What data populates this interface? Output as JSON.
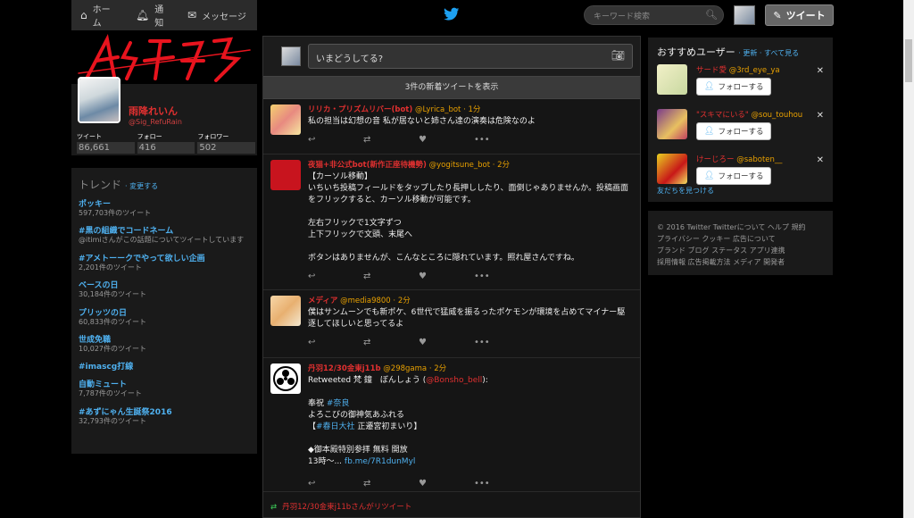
{
  "nav": {
    "home": "ホーム",
    "notifications": "通知",
    "messages": "メッセージ",
    "search_placeholder": "キーワード検索",
    "tweet_button": "ツイート"
  },
  "profile": {
    "name": "雨降れいん",
    "handle": "@Sig_RefuRain",
    "stats": [
      {
        "label": "ツイート",
        "value": "86,661"
      },
      {
        "label": "フォロー",
        "value": "416"
      },
      {
        "label": "フォロワー",
        "value": "502"
      }
    ]
  },
  "trends": {
    "title": "トレンド",
    "change": "· 変更する",
    "items": [
      {
        "title": "ポッキー",
        "sub": "597,703件のツイート"
      },
      {
        "title": "#黒の組織でコードネーム",
        "sub": "@itimiさんがこの話題についてツイートしています"
      },
      {
        "title": "#アメトーークでやって欲しい企画",
        "sub": "2,201件のツイート"
      },
      {
        "title": "ベースの日",
        "sub": "30,184件のツイート"
      },
      {
        "title": "プリッツの日",
        "sub": "60,833件のツイート"
      },
      {
        "title": "世成免職",
        "sub": "10,027件のツイート"
      },
      {
        "title": "#imascg打線",
        "sub": ""
      },
      {
        "title": "自動ミュート",
        "sub": "7,787件のツイート"
      },
      {
        "title": "#あずにゃん生誕祭2016",
        "sub": "32,793件のツイート"
      }
    ]
  },
  "composer": {
    "placeholder": "いまどうしてる?"
  },
  "new_tweets": "3件の新着ツイートを表示",
  "tweets": [
    {
      "name": "リリカ・プリズムリバー(bot)",
      "handle": "@Lyrica_bot",
      "time": "· 1分",
      "body": "私の担当は幻想の音 私が居ないと姉さん達の演奏は危険なのよ"
    },
    {
      "name": "夜猫+非公式bot(新作正座待機勢)",
      "handle": "@yogitsune_bot",
      "time": "· 2分",
      "body": "【カーソル移動】\nいちいち投稿フィールドをタップしたり長押ししたり、面倒じゃありませんか。投稿画面をフリックすると、カーソル移動が可能です。\n\n左右フリックで1文字ずつ\n上下フリックで文頭、末尾へ\n\nボタンはありませんが、こんなところに隠れています。照れ屋さんですね。"
    },
    {
      "name": "メディア",
      "handle": "@media9800",
      "time": "· 2分",
      "body": "僕はサンムーンでも新ポケ、6世代で猛威を振るったポケモンが環境を占めてマイナー駆逐してほしいと思ってるよ"
    },
    {
      "name": "丹羽12/30金東j11b",
      "handle": "@298gama",
      "time": "· 2分",
      "body_retweeted": "Retweeted 梵 鐘　ぼんしょう (",
      "body_retweeted_handle": "@Bonsho_bell",
      "body_retweeted_end": "):",
      "body_line2a": "奉祝 ",
      "body_tag1": "#奈良",
      "body_line3": "よろこびの御神気あふれる",
      "body_line4a": "【",
      "body_tag2": "#春日大社",
      "body_line4b": " 正遷宮初まいり】",
      "body_line5": "◆御本殿特別参拝 無料 開放",
      "body_line6a": "13時〜... ",
      "body_link": "fb.me/7R1dunMyl"
    }
  ],
  "retweet_line": "丹羽12/30金東j11bさんがリツイート",
  "who": {
    "title": "おすすめユーザー",
    "links": "· 更新 · すべて見る",
    "users": [
      {
        "name": "サード愛",
        "handle": "@3rd_eye_ya"
      },
      {
        "name": "\"スキマにいる\"",
        "handle": "@sou_touhou"
      },
      {
        "name": "けーじろー",
        "handle": "@saboten__"
      }
    ],
    "follow_label": "フォローする",
    "find_friends": "友だちを見つける"
  },
  "footer": {
    "line1": "© 2016 Twitter  Twitterについて  ヘルプ  規約",
    "line2": "プライバシー  クッキー  広告について",
    "line3": "ブランド  ブログ  ステータス  アプリ連携",
    "line4": "採用情報  広告掲載方法  メディア  開発者"
  }
}
